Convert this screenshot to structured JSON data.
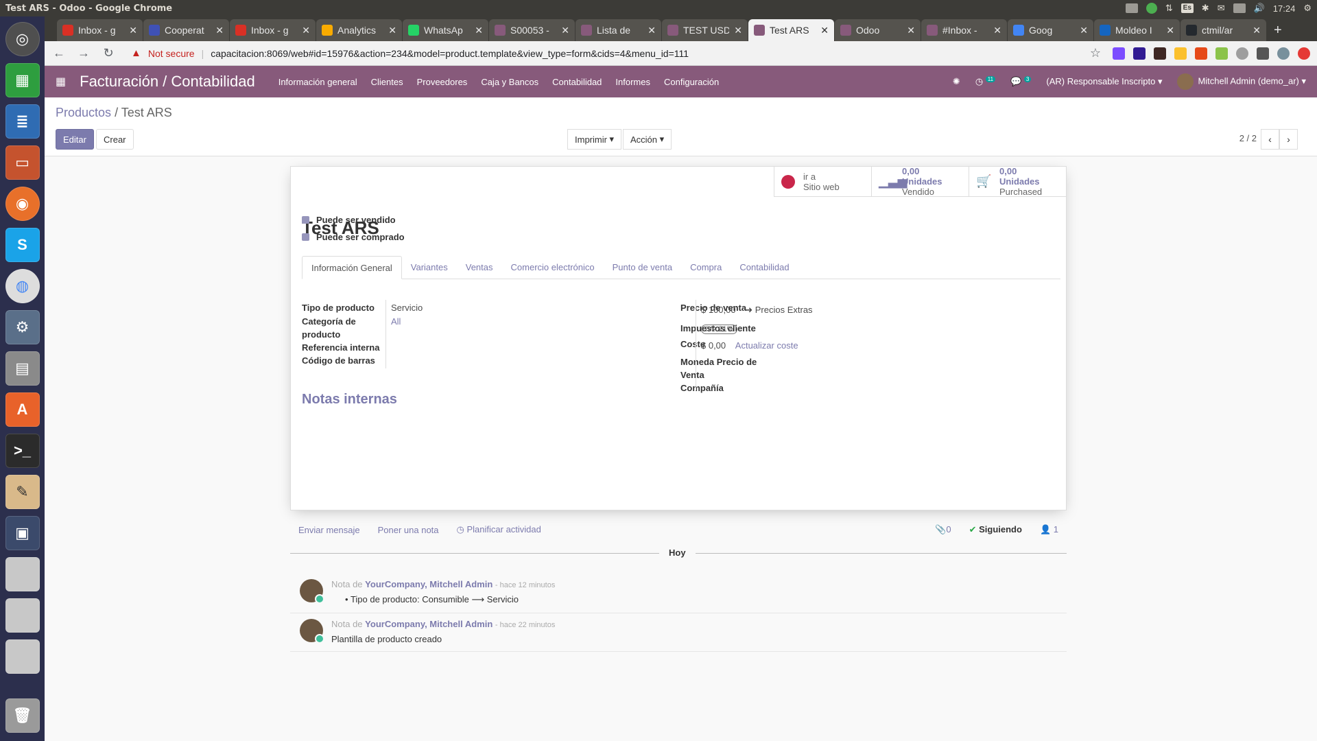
{
  "os": {
    "window_title": "Test ARS - Odoo - Google Chrome",
    "clock": "17:24",
    "kbd_layout": "Es"
  },
  "chrome": {
    "tabs": [
      {
        "label": "Inbox - g",
        "icon": "gmail-icon",
        "color": "#d93025"
      },
      {
        "label": "Cooperat",
        "icon": "calendar-icon",
        "color": "#3f51b5"
      },
      {
        "label": "Inbox - g",
        "icon": "gmail-icon",
        "color": "#d93025"
      },
      {
        "label": "Analytics",
        "icon": "analytics-icon",
        "color": "#f9ab00"
      },
      {
        "label": "WhatsAp",
        "icon": "whatsapp-icon",
        "color": "#25d366"
      },
      {
        "label": "S00053 -",
        "icon": "odoo-icon",
        "color": "#875a7b"
      },
      {
        "label": "Lista de",
        "icon": "odoo-icon",
        "color": "#875a7b"
      },
      {
        "label": "TEST USD",
        "icon": "odoo-icon",
        "color": "#875a7b"
      },
      {
        "label": "Test ARS",
        "icon": "odoo-icon",
        "color": "#875a7b"
      },
      {
        "label": "Odoo",
        "icon": "odoo-icon",
        "color": "#875a7b"
      },
      {
        "label": "#Inbox -",
        "icon": "odoo-icon",
        "color": "#875a7b"
      },
      {
        "label": "Goog",
        "icon": "google-icon",
        "color": "#4285f4"
      },
      {
        "label": "Moldeo I",
        "icon": "moldeo-icon",
        "color": "#1565c0"
      },
      {
        "label": "ctmil/ar",
        "icon": "github-icon",
        "color": "#24292e"
      }
    ],
    "active_tab_index": 8,
    "not_secure": "Not secure",
    "url": "capacitacion:8069/web#id=15976&action=234&model=product.template&view_type=form&cids=4&menu_id=111"
  },
  "odoo": {
    "app_title": "Facturación / Contabilidad",
    "menu": [
      "Información general",
      "Clientes",
      "Proveedores",
      "Caja y Bancos",
      "Contabilidad",
      "Informes",
      "Configuración"
    ],
    "activity_count": "11",
    "message_count": "3",
    "company_role": "(AR) Responsable Inscripto",
    "user": "Mitchell Admin (demo_ar)",
    "breadcrumb_parent": "Productos",
    "breadcrumb_sep": "/",
    "breadcrumb_current": "Test ARS",
    "edit_label": "Editar",
    "create_label": "Crear",
    "print_label": "Imprimir",
    "action_label": "Acción",
    "pager": "2 / 2",
    "stats": {
      "website_top": "ir a",
      "website_bottom": "Sitio web",
      "sold_value": "0,00 Unidades",
      "sold_label": "Vendido",
      "purchased_value": "0,00 Unidades",
      "purchased_label": "Purchased"
    },
    "product_name": "Test ARS",
    "can_be_sold": "Puede ser vendido",
    "can_be_purchased": "Puede ser comprado",
    "form_tabs": [
      "Información General",
      "Variantes",
      "Ventas",
      "Comercio electrónico",
      "Punto de venta",
      "Compra",
      "Contabilidad"
    ],
    "left_fields": {
      "type_label": "Tipo de producto",
      "type_value": "Servicio",
      "categ_label": "Categoría de producto",
      "categ_value": "All",
      "ref_label": "Referencia interna",
      "barcode_label": "Código de barras"
    },
    "right_fields": {
      "price_label": "Precio de venta",
      "price_value": "$ 100,00",
      "extra_prices": "Precios Extras",
      "taxes_label": "Impuestos cliente",
      "taxes_value": "IVA 21%",
      "cost_label": "Coste",
      "cost_value": "$ 0,00",
      "update_cost": "Actualizar coste",
      "currency_label": "Moneda Precio de Venta",
      "company_label": "Compañía"
    },
    "notes_title": "Notas internas",
    "chatter": {
      "send_message": "Enviar mensaje",
      "log_note": "Poner una nota",
      "schedule": "Planificar actividad",
      "attachments": "0",
      "following": "Siguiendo",
      "followers": "1",
      "today": "Hoy",
      "messages": [
        {
          "prefix": "Nota de",
          "author": "YourCompany, Mitchell Admin",
          "ago": "- hace 12 minutos",
          "body": "Tipo de producto: Consumible ⟶ Servicio"
        },
        {
          "prefix": "Nota de",
          "author": "YourCompany, Mitchell Admin",
          "ago": "- hace 22 minutos",
          "body": "Plantilla de producto creado"
        }
      ]
    }
  }
}
